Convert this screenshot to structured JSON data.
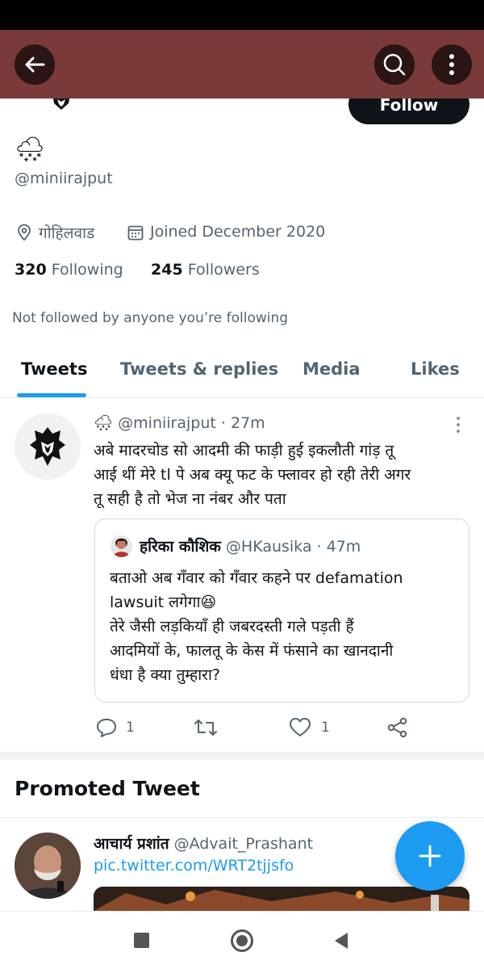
{
  "header": {
    "follow_label": "Follow"
  },
  "profile": {
    "display_emoji": "🌨",
    "handle": "@miniirajput",
    "location": "गोहिलवाड",
    "joined": "Joined December 2020",
    "following_count": "320",
    "following_label": "Following",
    "followers_count": "245",
    "followers_label": "Followers",
    "followed_by_note": "Not followed by anyone you’re following"
  },
  "tabs": [
    {
      "label": "Tweets",
      "selected": true
    },
    {
      "label": "Tweets & replies"
    },
    {
      "label": "Media"
    },
    {
      "label": "Likes"
    }
  ],
  "tweet": {
    "author_emoji": "🌨",
    "handle": "@miniirajput",
    "time": "· 27m",
    "lines": [
      "अबे मादरचोड सो आदमी की फाड़ी हुई इकलौती गांड़ तू",
      "आई थीं मेरे tl पे अब क्यू फट के फ्लावर हो रही तेरी अगर",
      "तू सही है तो भेज ना नंबर और पता"
    ],
    "quote": {
      "author_name": "हरिका कौशिक",
      "handle": "@HKausika",
      "time": "· 47m",
      "lines": [
        "बताओ अब गँवार को गँवार कहने पर defamation",
        "lawsuit लगेगा😆",
        "तेरे जैसी लड़कियाँ ही जबरदस्ती गले पड़ती हैं",
        "आदमियों के, फालतू के केस में फंसाने का खानदानी",
        "धंधा है क्या तुम्हारा?"
      ]
    },
    "reply_count": "1",
    "like_count": "1"
  },
  "promoted": {
    "heading": "Promoted Tweet",
    "author_name": "आचार्य प्रशांत",
    "handle": "@Advait_Prashant",
    "link": "pic.twitter.com/WRT2tjjsfo"
  },
  "icons": {
    "back": "back-arrow-icon",
    "search": "search-icon",
    "more": "more-vertical-icon",
    "location": "location-pin-icon",
    "calendar": "calendar-icon",
    "reply": "reply-icon",
    "retweet": "retweet-icon",
    "like": "heart-icon",
    "share": "share-icon",
    "compose": "plus-icon"
  },
  "colors": {
    "header_bg": "#7a3a3a",
    "accent": "#1d9bf0",
    "text": "#0f1419",
    "muted": "#536471"
  }
}
